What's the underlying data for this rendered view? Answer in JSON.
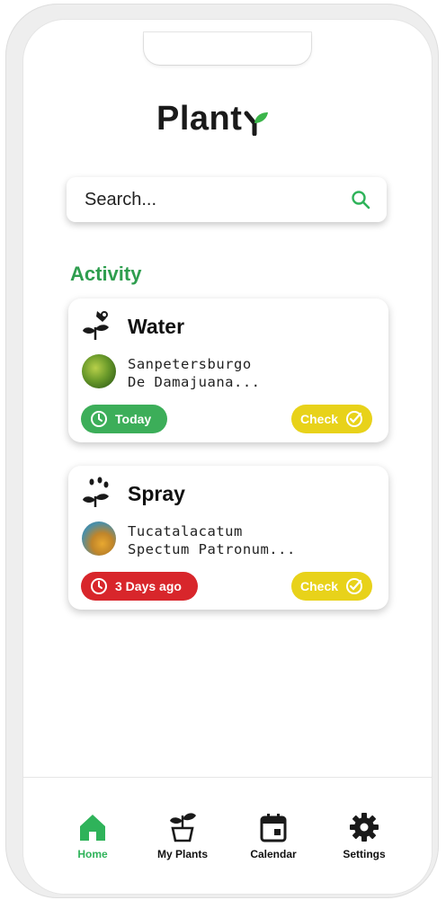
{
  "app": {
    "logo_text": "Plant"
  },
  "search": {
    "placeholder": "Search..."
  },
  "activity": {
    "title": "Activity",
    "cards": [
      {
        "action": "Water",
        "plant_line1": "Sanpetersburgo",
        "plant_line2": "De Damajuana...",
        "status_label": "Today",
        "status_color": "#3cae59",
        "check_label": "Check"
      },
      {
        "action": "Spray",
        "plant_line1": "Tucatalacatum",
        "plant_line2": "Spectum Patronum...",
        "status_label": "3 Days ago",
        "status_color": "#d8262b",
        "check_label": "Check"
      }
    ]
  },
  "nav": {
    "items": [
      {
        "label": "Home",
        "icon": "home-icon",
        "active": true
      },
      {
        "label": "My Plants",
        "icon": "potted-plant-icon",
        "active": false
      },
      {
        "label": "Calendar",
        "icon": "calendar-icon",
        "active": false
      },
      {
        "label": "Settings",
        "icon": "gear-icon",
        "active": false
      }
    ]
  },
  "colors": {
    "accent": "#2f9e4f",
    "active_nav": "#2fb35a",
    "check": "#e8d21a"
  }
}
